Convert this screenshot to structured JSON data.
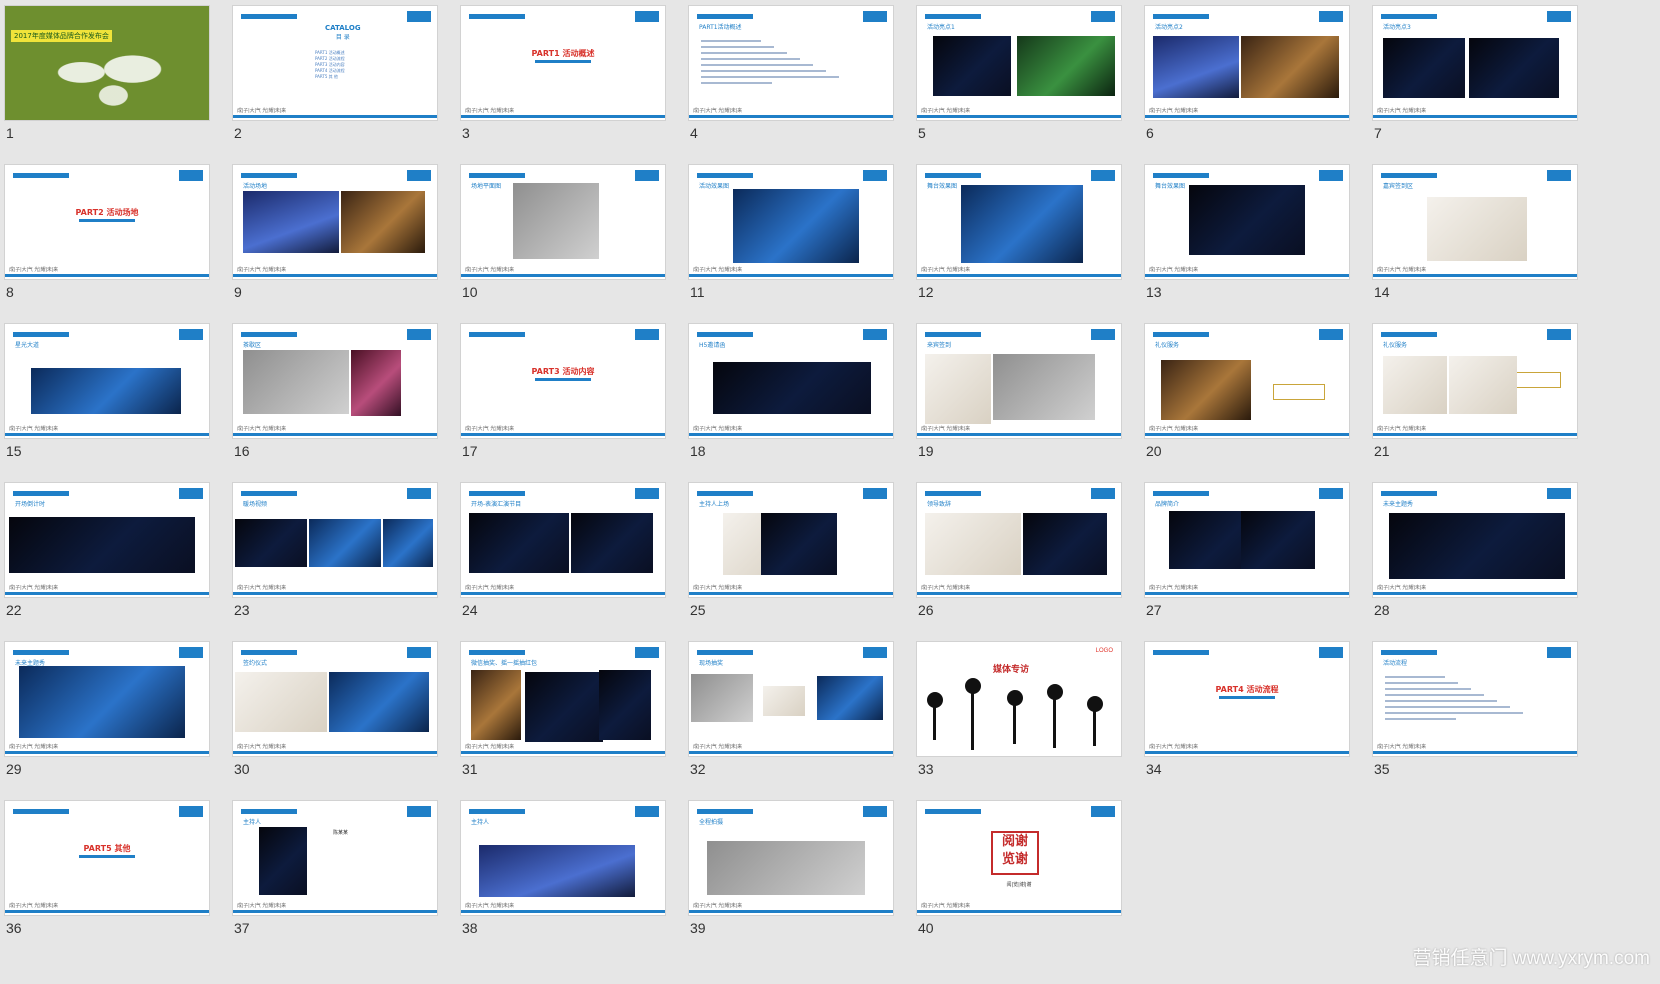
{
  "slides": [
    {
      "n": "1",
      "title": "2017年度媒体品牌合作发布会"
    },
    {
      "n": "2",
      "title": "CATALOG",
      "subtitle": "目 录",
      "items": [
        "PART1  活动概述",
        "PART2  活动流程",
        "PART3  活动内容",
        "PART4  活动流程",
        "PART5  其     他"
      ]
    },
    {
      "n": "3",
      "title": "PART1 活动概述"
    },
    {
      "n": "4",
      "title": "PART1活动概述"
    },
    {
      "n": "5",
      "title": "活动亮点1"
    },
    {
      "n": "6",
      "title": "活动亮点2"
    },
    {
      "n": "7",
      "title": "活动亮点3"
    },
    {
      "n": "8",
      "title": "PART2 活动场地"
    },
    {
      "n": "9",
      "title": "活动场地"
    },
    {
      "n": "10",
      "title": "场地平面图",
      "stage": "舞 台"
    },
    {
      "n": "11",
      "title": "活动效果图"
    },
    {
      "n": "12",
      "title": "舞台效果图"
    },
    {
      "n": "13",
      "title": "舞台效果图"
    },
    {
      "n": "14",
      "title": "嘉宾签到区"
    },
    {
      "n": "15",
      "title": "星光大道"
    },
    {
      "n": "16",
      "title": "茶歇区"
    },
    {
      "n": "17",
      "title": "PART3 活动内容"
    },
    {
      "n": "18",
      "title": "H5邀请函"
    },
    {
      "n": "19",
      "title": "来宾签到"
    },
    {
      "n": "20",
      "title": "礼仪服务"
    },
    {
      "n": "21",
      "title": "礼仪服务"
    },
    {
      "n": "22",
      "title": "开场倒计时"
    },
    {
      "n": "23",
      "title": "暖场视频"
    },
    {
      "n": "24",
      "title": "开场-表演汇演节目"
    },
    {
      "n": "25",
      "title": "主持人上场"
    },
    {
      "n": "26",
      "title": "领导致辞"
    },
    {
      "n": "27",
      "title": "品牌简介"
    },
    {
      "n": "28",
      "title": "未来主题秀"
    },
    {
      "n": "29",
      "title": "未来主题秀"
    },
    {
      "n": "30",
      "title": "签约仪式"
    },
    {
      "n": "31",
      "title": "微信抽奖、摇一摇抽红包"
    },
    {
      "n": "32",
      "title": "现场抽奖"
    },
    {
      "n": "33",
      "title": "媒体专访",
      "logo": "LOGO"
    },
    {
      "n": "34",
      "title": "PART4 活动流程"
    },
    {
      "n": "35",
      "title": "活动流程"
    },
    {
      "n": "36",
      "title": "PART5 其他"
    },
    {
      "n": "37",
      "title": "主持人",
      "name": "陈某某"
    },
    {
      "n": "38",
      "title": "主持人"
    },
    {
      "n": "39",
      "title": "全程拍摄"
    },
    {
      "n": "40",
      "title": "阅览谢谢",
      "thanks": [
        "阅",
        "谢",
        "览",
        "谢"
      ],
      "sub": "阅|览|谢|谢"
    }
  ],
  "footer_text": "成|子|大|气      光|耀|未|来",
  "watermark": "营销任意门 www.yxrym.com",
  "colors": {
    "accent": "#1f7fc7",
    "title_red": "#d8322b",
    "background": "#e6e6e6"
  }
}
